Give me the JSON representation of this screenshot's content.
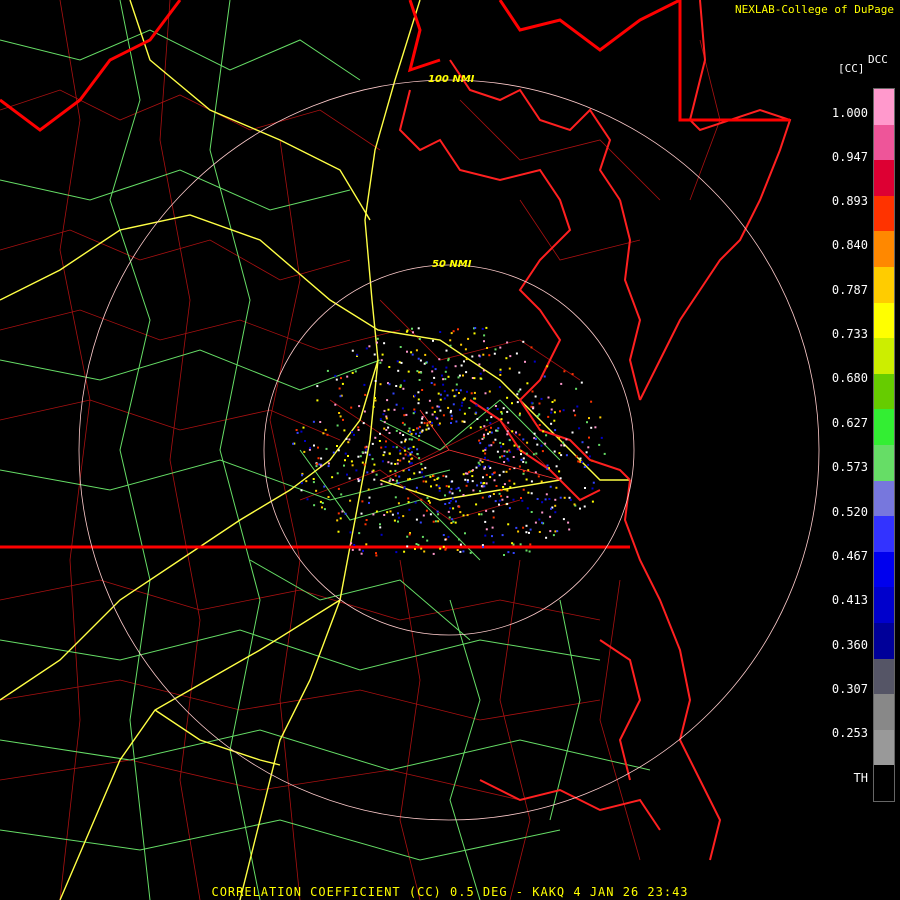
{
  "header": {
    "credit": "NEXLAB-College of DuPage",
    "product_code": "DCC",
    "product_unit": "[CC]"
  },
  "range_rings": [
    {
      "label": "100 NMI"
    },
    {
      "label": "50 NMI"
    }
  ],
  "colorbar": {
    "labels": [
      "1.000",
      "0.947",
      "0.893",
      "0.840",
      "0.787",
      "0.733",
      "0.680",
      "0.627",
      "0.573",
      "0.520",
      "0.467",
      "0.413",
      "0.360",
      "0.307",
      "0.253",
      "TH"
    ],
    "colors": [
      "#ff99cc",
      "#ee5599",
      "#dd0033",
      "#ff3300",
      "#ff8800",
      "#ffcc00",
      "#ffff00",
      "#ccee00",
      "#66cc00",
      "#33ee33",
      "#66dd66",
      "#7777dd",
      "#3333ff",
      "#0000ee",
      "#0000cc",
      "#000099",
      "#555566",
      "#888888",
      "#999999",
      "#000000"
    ]
  },
  "colors": {
    "state_borders": "#ff0000",
    "coastline": "#ff2020",
    "county_lines": "#bb1111",
    "highways": "#ffff44",
    "roads": "#66dd66",
    "range_rings": "#ffcccc"
  },
  "footer": {
    "text": "CORRELATION COEFFICIENT (CC) 0.5 DEG - KAKQ 4 JAN 26 23:43"
  }
}
